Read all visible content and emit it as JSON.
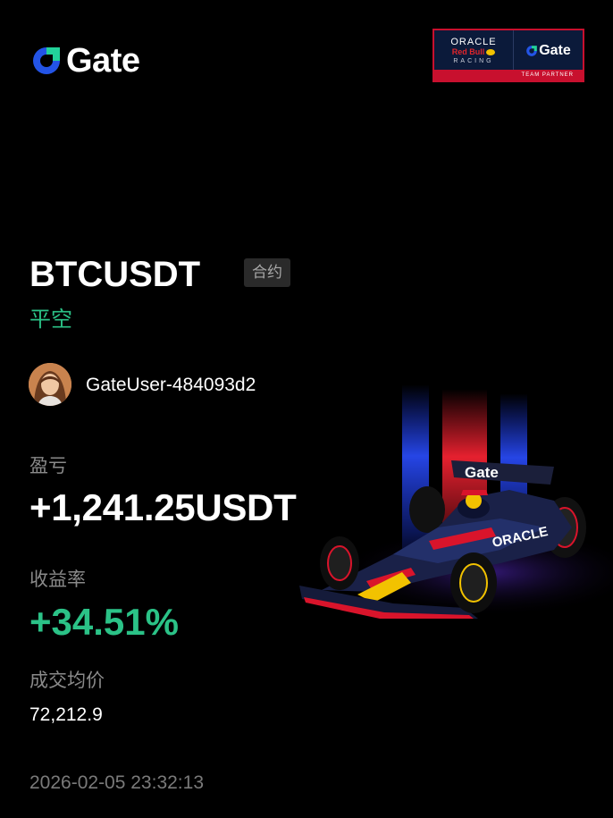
{
  "brand": {
    "name": "Gate",
    "accent": "#2354e6",
    "accent_green": "#22d39a"
  },
  "partner": {
    "oracle": "ORACLE",
    "redbull": "Red Bull",
    "racing": "RACING",
    "gate": "Gate",
    "footer": "TEAM PARTNER"
  },
  "trade": {
    "pair": "BTCUSDT",
    "market_tag": "合约",
    "action": "平空",
    "action_color": "#2bc287"
  },
  "user": {
    "avatar_icon": "avatar-photo",
    "name": "GateUser-484093d2"
  },
  "stats": {
    "pnl_label": "盈亏",
    "pnl_value": "+1,241.25USDT",
    "roi_label": "收益率",
    "roi_value": "+34.51%",
    "avg_price_label": "成交均价",
    "avg_price_value": "72,212.9"
  },
  "timestamp": "2026-02-05 23:32:13",
  "illustration": {
    "name": "f1-car-icon",
    "livery_text": "Gate",
    "sponsor_text": "ORACLE"
  }
}
